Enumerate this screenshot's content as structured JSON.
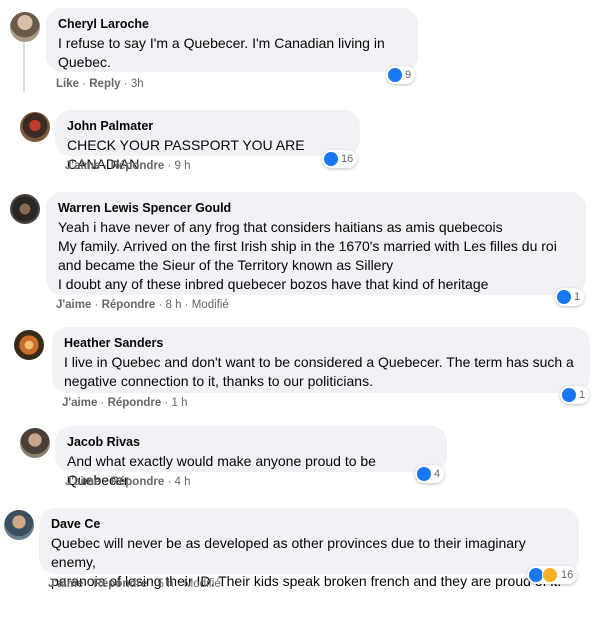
{
  "comments": [
    {
      "name": "Cheryl Laroche",
      "lines": [
        "I refuse to say I'm a Quebecer. I'm Canadian living in",
        "Quebec."
      ],
      "like": "Like",
      "reply": "Reply",
      "time": "3h",
      "edited": "",
      "reaction_count": "9",
      "reactions": [
        "like-icon"
      ]
    },
    {
      "name": "John Palmater",
      "lines": [
        "CHECK YOUR PASSPORT YOU ARE CANADIAN"
      ],
      "like": "J'aime",
      "reply": "Répondre",
      "time": "9 h",
      "edited": "",
      "reaction_count": "16",
      "reactions": [
        "like-icon"
      ]
    },
    {
      "name": "Warren Lewis Spencer Gould",
      "lines": [
        "Yeah i have never of any frog that considers haitians as amis quebecois",
        "My family. Arrived on the first Irish ship in the 1670's married with Les filles du roi",
        "and became the Sieur of the Territory known as Sillery",
        "I doubt any of these inbred quebecer bozos have that kind of heritage"
      ],
      "like": "J'aime",
      "reply": "Répondre",
      "time": "8 h",
      "edited": "Modifié",
      "reaction_count": "1",
      "reactions": [
        "like-icon"
      ]
    },
    {
      "name": "Heather Sanders",
      "lines": [
        "I live in Quebec and don't want to be considered a Quebecer. The term has such a",
        "negative connection to it, thanks to our politicians."
      ],
      "like": "J'aime",
      "reply": "Répondre",
      "time": "1 h",
      "edited": "",
      "reaction_count": "1",
      "reactions": [
        "like-icon"
      ]
    },
    {
      "name": "Jacob Rivas",
      "lines": [
        "And what exactly would make anyone proud to be Quebecer"
      ],
      "like": "J'aime",
      "reply": "Répondre",
      "time": "4 h",
      "edited": "",
      "reaction_count": "4",
      "reactions": [
        "like-icon"
      ]
    },
    {
      "name": "Dave Ce",
      "lines": [
        "Quebec will never be as developed as other provinces due to their imaginary enemy,",
        "paranoia of losing their ID. Their kids speak broken french and they are proud of it."
      ],
      "like": "J'aime",
      "reply": "Répondre",
      "time": "5 h",
      "edited": "Modifié",
      "reaction_count": "16",
      "reactions": [
        "like-icon",
        "haha-icon"
      ]
    }
  ],
  "colors": {
    "bubble": "#f0f2f5",
    "like_blue": "#1877f2",
    "meta_gray": "#65676b"
  }
}
